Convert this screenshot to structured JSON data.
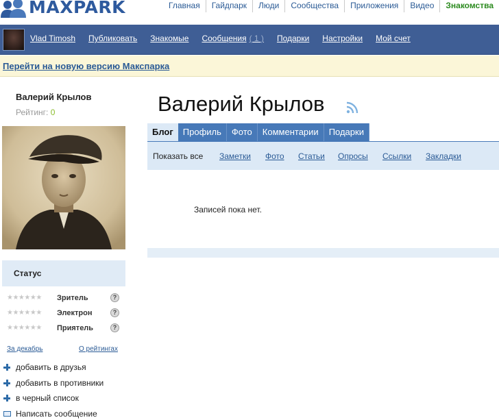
{
  "header": {
    "logo_text": "MAXPARK",
    "nav": [
      "Главная",
      "Гайдпарк",
      "Люди",
      "Сообщества",
      "Приложения",
      "Видео",
      "Знакомства"
    ],
    "active_nav": "Знакомства",
    "brand_color": "#2e5a9e"
  },
  "userbar": {
    "username": "Vlad Timosh",
    "links": [
      "Публиковать",
      "Знакомые",
      "Сообщения",
      "Подарки",
      "Настройки",
      "Мой счет"
    ],
    "messages_count": "( 1 )",
    "bar_color": "#3f5e95"
  },
  "notice": {
    "link_text": "Перейти на новую версию Макспарка"
  },
  "profile": {
    "name": "Валерий Крылов",
    "rating_label": "Рейтинг:",
    "rating_value": "0",
    "status_title": "Статус",
    "ranks": [
      "Зритель",
      "Электрон",
      "Приятель"
    ],
    "stars": "★★★★★★",
    "help_symbol": "?",
    "period_link": "За декабрь",
    "ratings_link": "О рейтингах",
    "actions": [
      "добавить в друзья",
      "добавить в противники",
      "в черный список",
      "Написать сообщение"
    ]
  },
  "main": {
    "title": "Валерий Крылов",
    "tabs": [
      "Блог",
      "Профиль",
      "Фото",
      "Комментарии",
      "Подарки"
    ],
    "active_tab": "Блог",
    "filters": [
      "Показать все",
      "Заметки",
      "Фото",
      "Статьи",
      "Опросы",
      "Ссылки",
      "Закладки"
    ],
    "empty_text": "Записей пока нет.",
    "tab_color": "#4779b8",
    "subbar_color": "#dce9f6"
  }
}
